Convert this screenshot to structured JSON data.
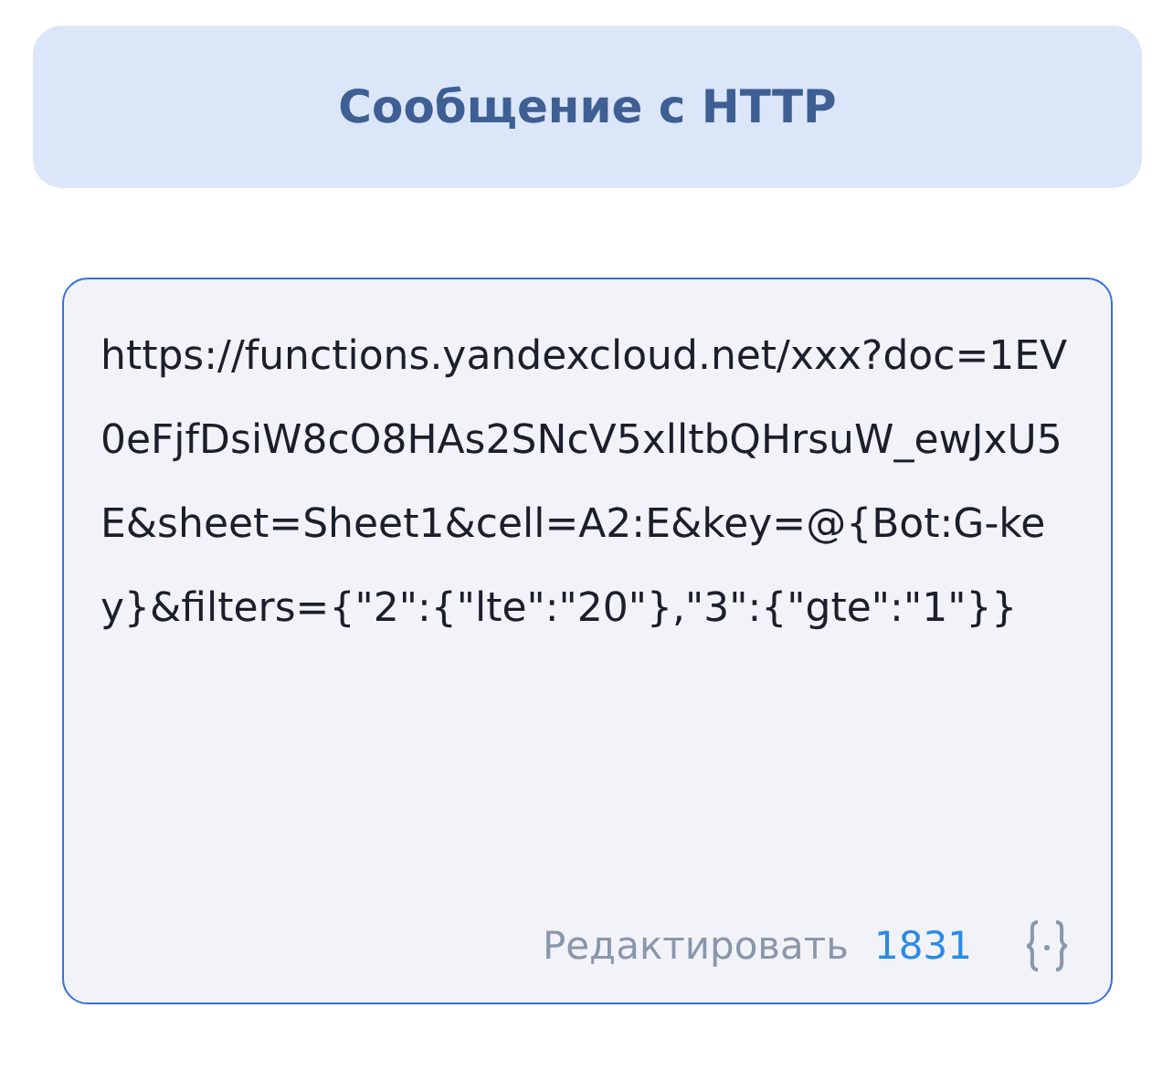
{
  "header": {
    "title": "Сообщение с HTTP"
  },
  "url_field": {
    "value": "https://functions.yandexcloud.net/xxx?doc=1EV0eFjfDsiW8cO8HAs2SNcV5xlltbQHrsuW_ewJxU5E&sheet=Sheet1&cell=A2:E&key=@{Bot:G-key}&filters={\"2\":{\"lte\":\"20\"},\"3\":{\"gte\":\"1\"}}"
  },
  "footer": {
    "edit_link": "Редактировать",
    "counter": "1831"
  }
}
